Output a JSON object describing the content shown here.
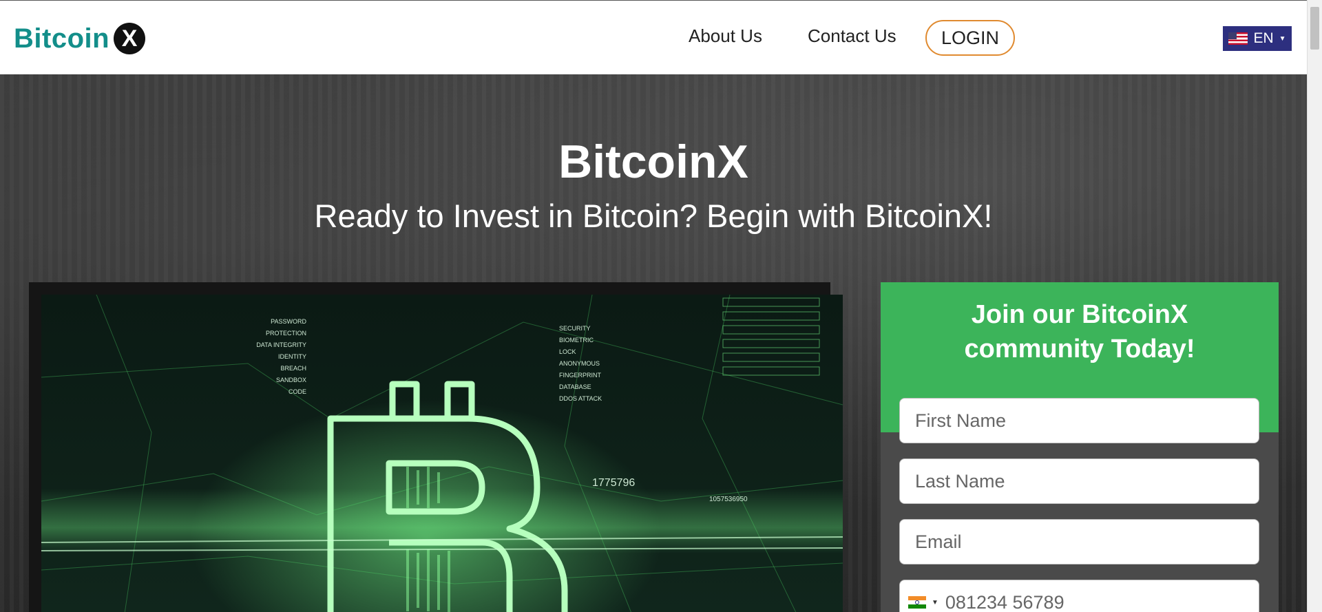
{
  "header": {
    "logo_text": "Bitcoin",
    "logo_mark": "X",
    "nav": [
      {
        "label": "About Us"
      },
      {
        "label": "Contact Us"
      }
    ],
    "login_label": "LOGIN",
    "language": {
      "label": "EN",
      "flag": "us-flag-icon"
    }
  },
  "hero": {
    "title": "BitcoinX",
    "subtitle": "Ready to Invest in Bitcoin? Begin with BitcoinX!"
  },
  "video": {
    "labels_left": [
      "PASSWORD",
      "PROTECTION",
      "DATA INTEGRITY",
      "IDENTITY",
      "BREACH",
      "SANDBOX",
      "CODE"
    ],
    "labels_right": [
      "SECURITY",
      "BIOMETRIC",
      "LOCK",
      "ANONYMOUS",
      "FINGERPRINT",
      "DATABASE",
      "DDOS ATTACK"
    ],
    "number_1": "1775796",
    "number_2": "1057536950"
  },
  "form": {
    "title_line1": "Join our BitcoinX",
    "title_line2": "community Today!",
    "first_name_placeholder": "First Name",
    "last_name_placeholder": "Last Name",
    "email_placeholder": "Email",
    "phone_placeholder": "081234 56789",
    "phone_flag": "india-flag-icon"
  },
  "colors": {
    "brand_teal": "#138e8a",
    "form_green": "#3cb45a",
    "login_border": "#e08a2f",
    "lang_bg": "#2d2f7f"
  }
}
